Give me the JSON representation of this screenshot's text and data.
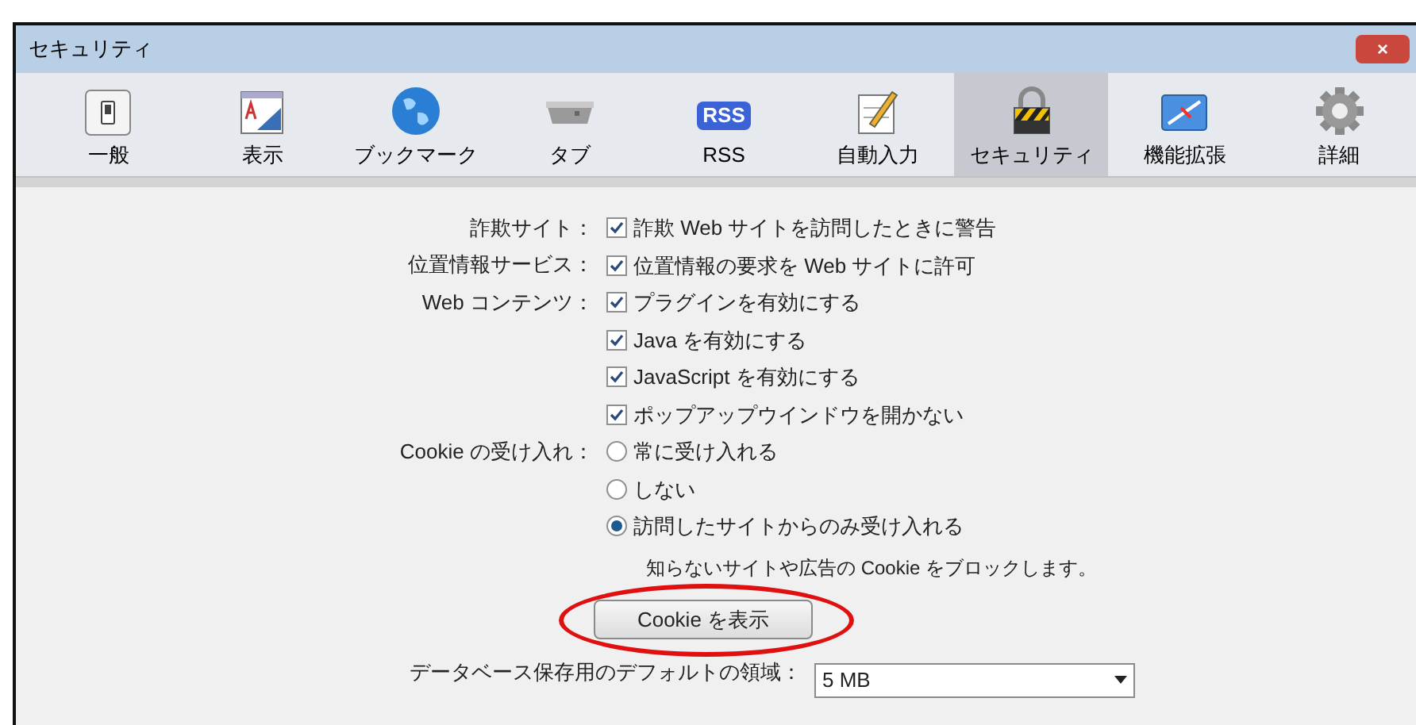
{
  "window": {
    "title": "セキュリティ",
    "close": "×"
  },
  "toolbar": [
    {
      "label": "一般",
      "selected": false
    },
    {
      "label": "表示",
      "selected": false
    },
    {
      "label": "ブックマーク",
      "selected": false
    },
    {
      "label": "タブ",
      "selected": false
    },
    {
      "label": "RSS",
      "badge": "RSS",
      "selected": false
    },
    {
      "label": "自動入力",
      "selected": false
    },
    {
      "label": "セキュリティ",
      "selected": true
    },
    {
      "label": "機能拡張",
      "selected": false
    },
    {
      "label": "詳細",
      "selected": false
    }
  ],
  "settings": [
    {
      "kind": "checkbox",
      "label": "詐欺サイト：",
      "text": "詐欺 Web サイトを訪問したときに警告",
      "checked": true
    },
    {
      "kind": "checkbox",
      "label": "位置情報サービス：",
      "text": "位置情報の要求を Web サイトに許可",
      "checked": true
    },
    {
      "kind": "checkbox",
      "label": "Web コンテンツ：",
      "text": "プラグインを有効にする",
      "checked": true
    },
    {
      "kind": "checkbox",
      "text": "Java を有効にする",
      "checked": true
    },
    {
      "kind": "checkbox",
      "text": "JavaScript を有効にする",
      "checked": true
    },
    {
      "kind": "checkbox",
      "text": "ポップアップウインドウを開かない",
      "checked": true
    },
    {
      "kind": "radio",
      "label": "Cookie の受け入れ：",
      "text": "常に受け入れる",
      "selected": false
    },
    {
      "kind": "radio",
      "text": "しない",
      "selected": false
    },
    {
      "kind": "radio",
      "text": "訪問したサイトからのみ受け入れる",
      "selected": true
    },
    {
      "kind": "note",
      "text": "知らないサイトや広告の Cookie をブロックします。"
    },
    {
      "kind": "button",
      "text": "Cookie を表示",
      "highlighted": true
    },
    {
      "kind": "select",
      "label": "データベース保存用のデフォルトの領域：",
      "text": "5 MB"
    }
  ]
}
